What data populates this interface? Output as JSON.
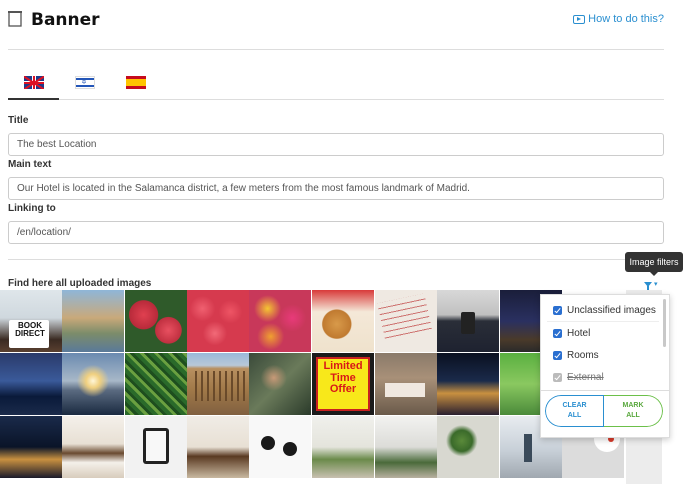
{
  "header": {
    "title": "Banner",
    "help_link": "How to do this?"
  },
  "language_tabs": [
    {
      "name": "English",
      "flag": "uk-flag",
      "active": true
    },
    {
      "name": "Hebrew",
      "flag": "israel-flag",
      "active": false
    },
    {
      "name": "Spanish",
      "flag": "spain-flag",
      "active": false
    }
  ],
  "form": {
    "title_label": "Title",
    "title_value": "The best Location",
    "main_text_label": "Main text",
    "main_text_value": "Our Hotel is located in the Salamanca district, a few meters from the most famous landmark of Madrid.",
    "linking_label": "Linking to",
    "linking_value": "/en/location/"
  },
  "images": {
    "section_label": "Find here all uploaded images",
    "filter_tooltip": "Image filters",
    "tile_texts": {
      "book_direct": "BOOK\nDIRECT",
      "limited_offer": "Limited\nTime\nOffer"
    }
  },
  "filters": {
    "options": [
      {
        "label": "Unclassified images",
        "checked": true,
        "disabled": false
      },
      {
        "label": "Hotel",
        "checked": true,
        "disabled": false
      },
      {
        "label": "Rooms",
        "checked": true,
        "disabled": false
      },
      {
        "label": "External",
        "checked": true,
        "disabled": true
      }
    ],
    "clear_all": "CLEAR\nALL",
    "mark_all": "MARK\nALL"
  },
  "colors": {
    "accent": "#2a8fd0",
    "mark_all": "#6cc04a",
    "checkbox": "#2a6fd0"
  }
}
